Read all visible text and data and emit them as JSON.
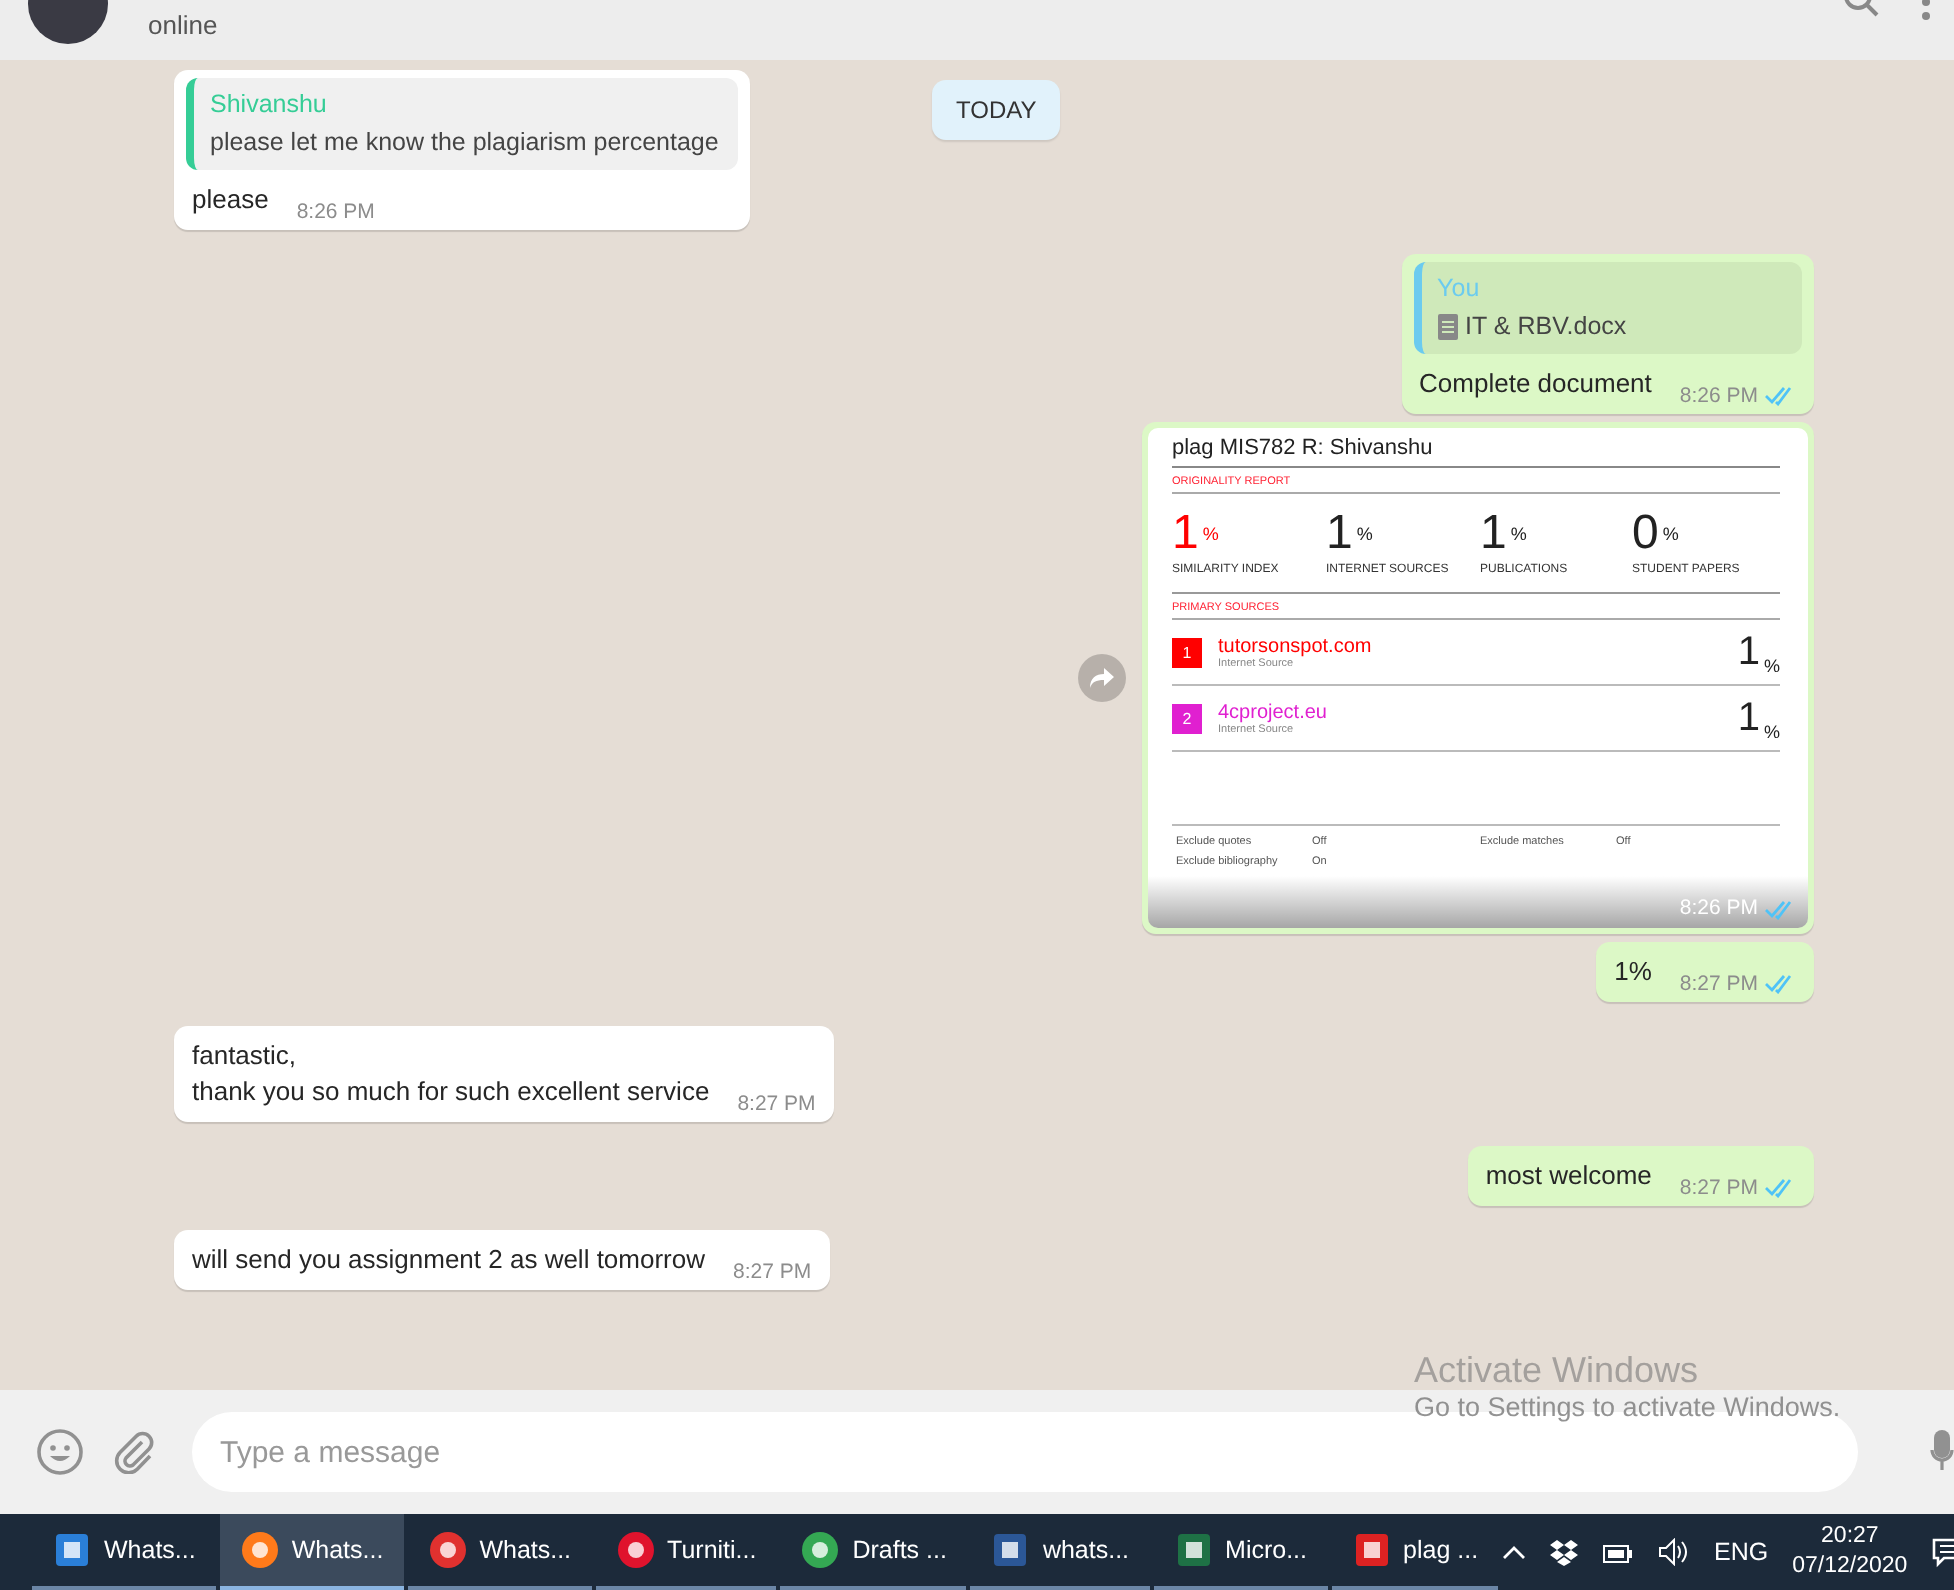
{
  "header": {
    "status": "online"
  },
  "date_chip": "TODAY",
  "messages": [
    {
      "kind": "incoming",
      "quote": {
        "author": "Shivanshu",
        "text": "please let me know the plagiarism percentage"
      },
      "text": "please",
      "time": "8:26 PM"
    },
    {
      "kind": "outgoing",
      "quote": {
        "author": "You",
        "file": "IT & RBV.docx"
      },
      "text": "Complete document",
      "time": "8:26 PM",
      "read": true
    },
    {
      "kind": "report",
      "time": "8:26 PM",
      "read": true,
      "report": {
        "title": "plag MIS782 R: Shivanshu",
        "section": "ORIGINALITY REPORT",
        "stats": [
          {
            "value": "1",
            "unit": "%",
            "label": "SIMILARITY INDEX",
            "color": "#ff0000"
          },
          {
            "value": "1",
            "unit": "%",
            "label": "INTERNET SOURCES",
            "color": "#222222"
          },
          {
            "value": "1",
            "unit": "%",
            "label": "PUBLICATIONS",
            "color": "#222222"
          },
          {
            "value": "0",
            "unit": "%",
            "label": "STUDENT PAPERS",
            "color": "#222222"
          }
        ],
        "sources_title": "PRIMARY SOURCES",
        "sources": [
          {
            "index": "1",
            "name": "tutorsonspot.com",
            "type": "Internet Source",
            "value": "1",
            "unit": "%",
            "color": "#ff0000"
          },
          {
            "index": "2",
            "name": "4cproject.eu",
            "type": "Internet Source",
            "value": "1",
            "unit": "%",
            "color": "#e020d0"
          }
        ],
        "footer": [
          {
            "label": "Exclude quotes",
            "value": "Off"
          },
          {
            "label": "Exclude matches",
            "value": "Off"
          },
          {
            "label": "Exclude bibliography",
            "value": "On"
          }
        ]
      }
    },
    {
      "kind": "outgoing",
      "text": "1%",
      "time": "8:27 PM",
      "read": true
    },
    {
      "kind": "incoming",
      "text": "fantastic,\nthank you so much for such excellent service",
      "time": "8:27 PM"
    },
    {
      "kind": "outgoing",
      "text": "most welcome",
      "time": "8:27 PM",
      "read": true
    },
    {
      "kind": "incoming",
      "text": "will send you assignment 2 as well tomorrow",
      "time": "8:27 PM"
    }
  ],
  "activation": {
    "title": "Activate Windows",
    "text": "Go to Settings to activate Windows."
  },
  "composer": {
    "placeholder": "Type a message"
  },
  "taskbar": {
    "apps": [
      {
        "kind": "maxthon",
        "label": "Whats...",
        "selected": false
      },
      {
        "kind": "firefox",
        "label": "Whats...",
        "selected": true
      },
      {
        "kind": "vivaldi",
        "label": "Whats...",
        "selected": false
      },
      {
        "kind": "opera",
        "label": "Turniti...",
        "selected": false
      },
      {
        "kind": "chrome",
        "label": "Drafts ...",
        "selected": false
      },
      {
        "kind": "word",
        "label": "whats...",
        "selected": false
      },
      {
        "kind": "excel",
        "label": "Micro...",
        "selected": false
      },
      {
        "kind": "pdf",
        "label": "plag ...",
        "selected": false
      }
    ],
    "language": "ENG",
    "time": "20:27",
    "date": "07/12/2020"
  }
}
